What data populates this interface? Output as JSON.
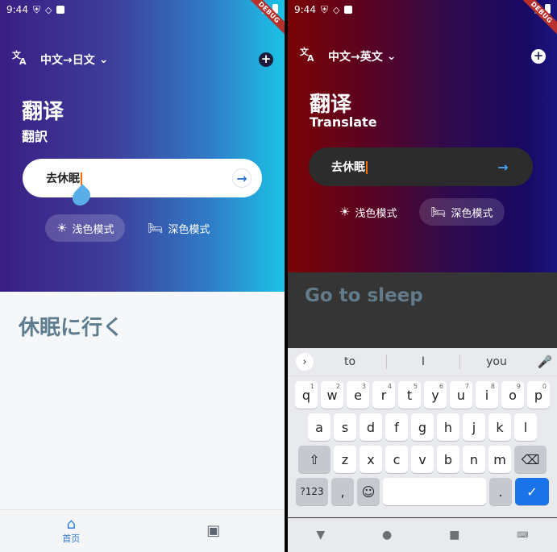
{
  "left_screen": {
    "status": {
      "time": "9:44"
    },
    "debug_banner": "DEBUG",
    "lang_selector": "中文→日文",
    "title": "翻译",
    "subtitle": "翻訳",
    "input_text": "去休眠",
    "modes": [
      {
        "label": "浅色模式",
        "active": true
      },
      {
        "label": "深色模式",
        "active": false
      }
    ],
    "result": "休眠に行く",
    "nav": [
      {
        "label": "首页",
        "icon": "home-icon",
        "active": true
      },
      {
        "label": "",
        "icon": "contact-icon",
        "active": false
      }
    ]
  },
  "right_screen": {
    "status": {
      "time": "9:44"
    },
    "debug_banner": "DEBUG",
    "lang_selector": "中文→英文",
    "title": "翻译",
    "subtitle": "Translate",
    "input_text": "去休眠",
    "modes": [
      {
        "label": "浅色模式",
        "active": false
      },
      {
        "label": "深色模式",
        "active": true
      }
    ],
    "result": "Go to sleep",
    "keyboard": {
      "suggestions": [
        "to",
        "I",
        "you"
      ],
      "row1": [
        "q",
        "w",
        "e",
        "r",
        "t",
        "y",
        "u",
        "i",
        "o",
        "p"
      ],
      "row1_hints": [
        "1",
        "2",
        "3",
        "4",
        "5",
        "6",
        "7",
        "8",
        "9",
        "0"
      ],
      "row2": [
        "a",
        "s",
        "d",
        "f",
        "g",
        "h",
        "j",
        "k",
        "l"
      ],
      "row3": [
        "z",
        "x",
        "c",
        "v",
        "b",
        "n",
        "m"
      ],
      "symbols_key": "?123",
      "comma_key": ",",
      "period_key": "."
    }
  },
  "colors": {
    "accent_blue": "#2e7bd7",
    "light_header_start": "#3a1e83",
    "light_header_end": "#1bc3e6",
    "dark_header_start": "#7a0305",
    "dark_header_end": "#1a157e",
    "result_text": "#5e7d8e"
  }
}
